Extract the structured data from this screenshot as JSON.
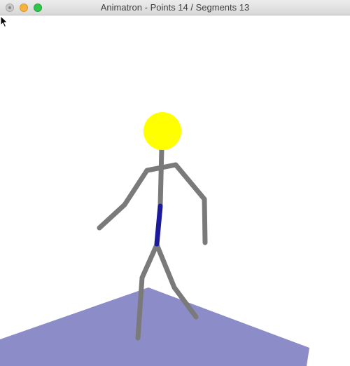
{
  "window": {
    "title": "Animatron - Points 14 / Segments 13"
  },
  "colors": {
    "ground": "#8c8cc8",
    "limb": "#7a7a7a",
    "spine": "#1a1a9a",
    "head": "#ffff00"
  },
  "icons": {
    "close": "close-icon",
    "minimize": "minimize-icon",
    "zoom": "zoom-icon",
    "cursor": "cursor-arrow-icon"
  }
}
